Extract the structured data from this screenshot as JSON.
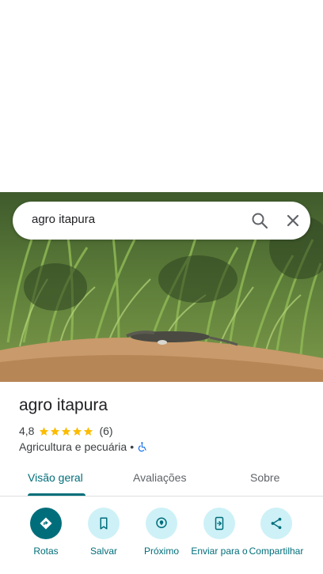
{
  "search": {
    "query": "agro itapura"
  },
  "place": {
    "name": "agro itapura",
    "rating": "4,8",
    "stars": 5,
    "review_count": "(6)",
    "category": "Agricultura e pecuária",
    "separator": "•"
  },
  "tabs": [
    {
      "label": "Visão geral",
      "active": true
    },
    {
      "label": "Avaliações",
      "active": false
    },
    {
      "label": "Sobre",
      "active": false
    }
  ],
  "actions": [
    {
      "label": "Rotas",
      "icon": "directions-icon"
    },
    {
      "label": "Salvar",
      "icon": "bookmark-icon"
    },
    {
      "label": "Próximo",
      "icon": "nearby-icon"
    },
    {
      "label": "Enviar para o",
      "icon": "send-to-phone-icon"
    },
    {
      "label": "Compartilhar",
      "icon": "share-icon"
    }
  ],
  "colors": {
    "accent": "#006e7a",
    "action_bg": "#cdf1f7",
    "star": "#fbbc04",
    "wheelchair": "#1a73e8"
  }
}
